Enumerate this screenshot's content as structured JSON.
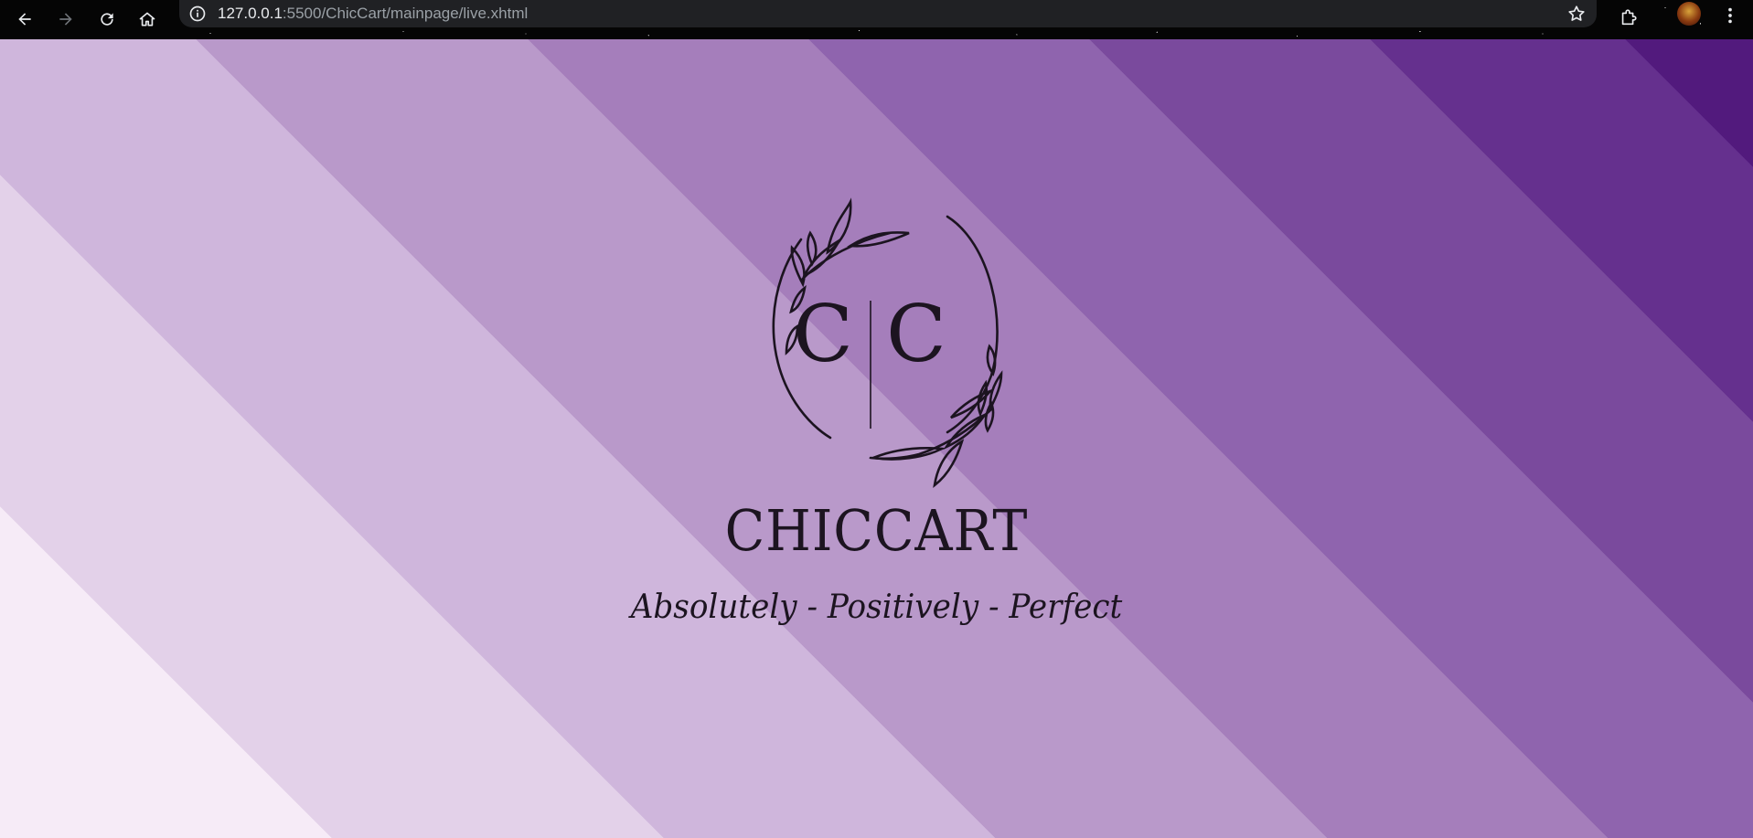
{
  "browser": {
    "url_host": "127.0.0.1",
    "url_rest": ":5500/ChicCart/mainpage/live.xhtml",
    "icons": {
      "back": "back-arrow-icon",
      "forward": "forward-arrow-icon",
      "reload": "reload-icon",
      "home": "home-icon",
      "site_info": "info-icon",
      "bookmark": "star-icon",
      "extensions": "puzzle-icon",
      "profile": "avatar",
      "menu": "kebab-menu-icon"
    }
  },
  "hero": {
    "monogram_left": "C",
    "monogram_right": "C",
    "brand_name": "CHICCART",
    "tagline": "Absolutely - Positively - Perfect"
  },
  "colors": {
    "ink": "#1c1420",
    "stripe_lightest": "#f6ebf7",
    "stripe_darkest": "#521a7d"
  }
}
